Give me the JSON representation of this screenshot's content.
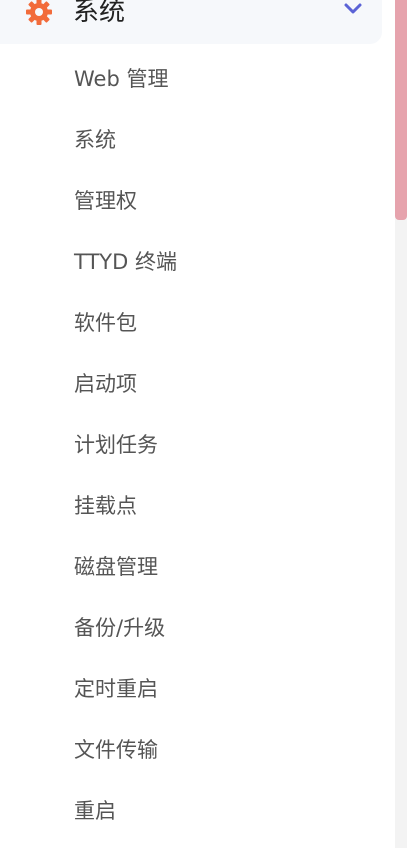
{
  "group": {
    "title": "系统",
    "icon": "gear-icon",
    "icon_color": "#f26b3a",
    "chevron_icon": "chevron-down-icon",
    "chevron_color": "#5b63d6",
    "expanded": true
  },
  "menu": {
    "items": [
      {
        "label": "Web 管理"
      },
      {
        "label": "系统"
      },
      {
        "label": "管理权"
      },
      {
        "label": "TTYD 终端"
      },
      {
        "label": "软件包"
      },
      {
        "label": "启动项"
      },
      {
        "label": "计划任务"
      },
      {
        "label": "挂载点"
      },
      {
        "label": "磁盘管理"
      },
      {
        "label": "备份/升级"
      },
      {
        "label": "定时重启"
      },
      {
        "label": "文件传输"
      },
      {
        "label": "重启"
      }
    ]
  },
  "scrollbar": {
    "thumb_color": "#e6a3ad",
    "track_color": "#f3f3f3"
  }
}
